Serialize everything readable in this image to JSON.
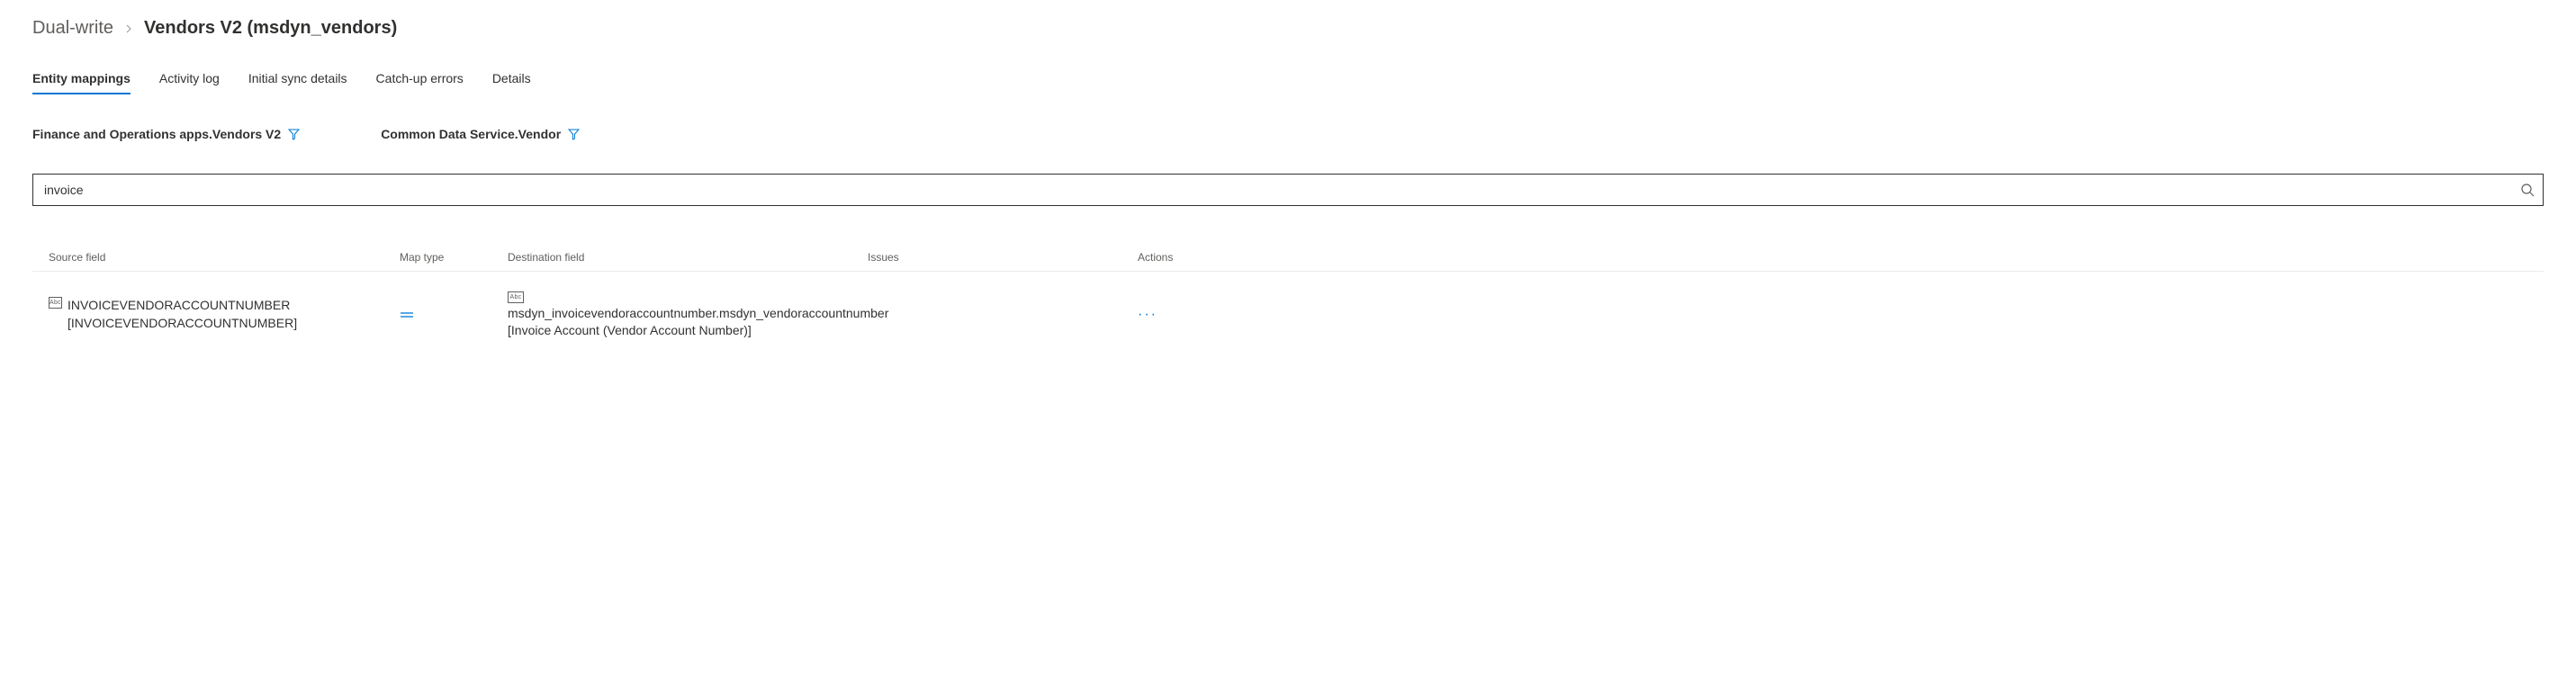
{
  "breadcrumb": {
    "parent": "Dual-write",
    "current": "Vendors V2 (msdyn_vendors)"
  },
  "tabs": [
    {
      "label": "Entity mappings",
      "active": true
    },
    {
      "label": "Activity log",
      "active": false
    },
    {
      "label": "Initial sync details",
      "active": false
    },
    {
      "label": "Catch-up errors",
      "active": false
    },
    {
      "label": "Details",
      "active": false
    }
  ],
  "entities": {
    "left": "Finance and Operations apps.Vendors V2",
    "right": "Common Data Service.Vendor"
  },
  "search": {
    "value": "invoice"
  },
  "table": {
    "headers": {
      "source": "Source field",
      "maptype": "Map type",
      "destination": "Destination field",
      "issues": "Issues",
      "actions": "Actions"
    },
    "rows": [
      {
        "source_type": "Abc",
        "source": "INVOICEVENDORACCOUNTNUMBER [INVOICEVENDORACCOUNTNUMBER]",
        "maptype": "=",
        "dest_type": "Abc",
        "destination": "msdyn_invoicevendoraccountnumber.msdyn_vendoraccountnumber [Invoice Account (Vendor Account Number)]",
        "issues": "",
        "actions": "···"
      }
    ]
  }
}
